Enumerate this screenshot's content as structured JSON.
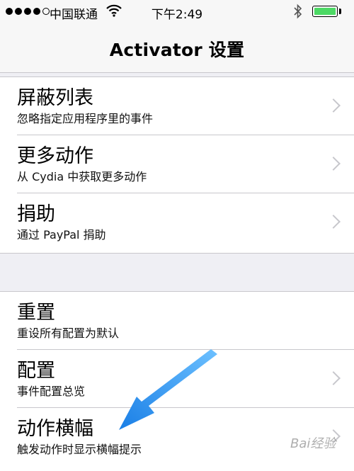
{
  "status_bar": {
    "carrier": "中国联通",
    "time": "下午2:49",
    "wifi_icon": "wifi-icon",
    "bluetooth_icon": "bluetooth-icon",
    "battery_color": "#4cd964"
  },
  "navbar": {
    "title": "Activator 设置"
  },
  "groups": [
    {
      "cells": [
        {
          "title": "屏蔽列表",
          "subtitle": "忽略指定应用程序里的事件"
        },
        {
          "title": "更多动作",
          "subtitle": "从 Cydia 中获取更多动作"
        },
        {
          "title": "捐助",
          "subtitle": "通过 PayPal 捐助"
        }
      ]
    },
    {
      "cells": [
        {
          "title": "重置",
          "subtitle": "重设所有配置为默认"
        },
        {
          "title": "配置",
          "subtitle": "事件配置总览"
        },
        {
          "title": "动作横幅",
          "subtitle": "触发动作时显示横幅提示"
        }
      ]
    }
  ],
  "annotation": {
    "arrow_color": "#2a8cf0"
  },
  "watermark": "Bai经验"
}
